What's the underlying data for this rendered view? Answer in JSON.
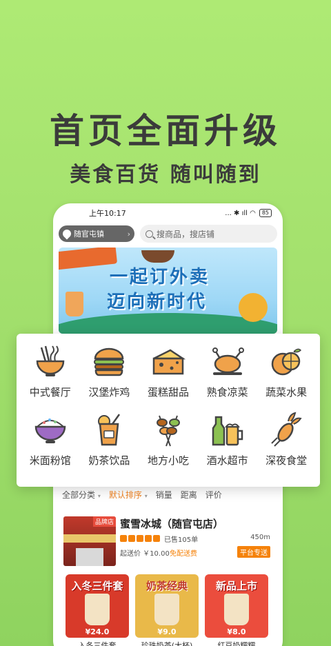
{
  "promo": {
    "headline": "首页全面升级",
    "subline": "美食百货 随叫随到"
  },
  "status_bar": {
    "time": "上午10:17",
    "icons": "... ✱ ıll ◠",
    "battery": "85"
  },
  "top": {
    "location": "随官屯镇",
    "search_placeholder": "搜商品，搜店铺"
  },
  "banner": {
    "line1": "一起订外卖",
    "line2": "迈向新时代"
  },
  "categories": [
    {
      "label": "中式餐厅",
      "icon": "noodle-bowl-icon"
    },
    {
      "label": "汉堡炸鸡",
      "icon": "burger-icon"
    },
    {
      "label": "蛋糕甜品",
      "icon": "cake-icon"
    },
    {
      "label": "熟食凉菜",
      "icon": "roast-chicken-icon"
    },
    {
      "label": "蔬菜水果",
      "icon": "orange-icon"
    },
    {
      "label": "米面粉馆",
      "icon": "rice-bowl-icon"
    },
    {
      "label": "奶茶饮品",
      "icon": "drink-icon"
    },
    {
      "label": "地方小吃",
      "icon": "skewer-icon"
    },
    {
      "label": "酒水超市",
      "icon": "beer-icon"
    },
    {
      "label": "深夜食堂",
      "icon": "lobster-icon"
    }
  ],
  "sort": {
    "all": "全部分类",
    "default": "默认排序",
    "sales": "销量",
    "distance": "距离",
    "rating": "评价"
  },
  "shop": {
    "badge": "品牌店",
    "name": "蜜雪冰城（随官屯店）",
    "sold": "已售105单",
    "distance": "450m",
    "min_price": "起送价 ￥10.00",
    "free_delivery": "免配送费",
    "platform": "平台专送"
  },
  "products": [
    {
      "title": "入冬三件套",
      "price": "¥24.0",
      "name": "入冬三件套"
    },
    {
      "title": "奶茶经典",
      "price": "¥9.0",
      "name": "珍珠奶茶(大杯)"
    },
    {
      "title": "新品上市",
      "price": "¥8.0",
      "name": "红豆奶糯糯"
    }
  ],
  "colors": {
    "accent": "#f5820a",
    "background": "#a3e06d",
    "icon_orange": "#f0a24a",
    "icon_dark": "#444444"
  }
}
